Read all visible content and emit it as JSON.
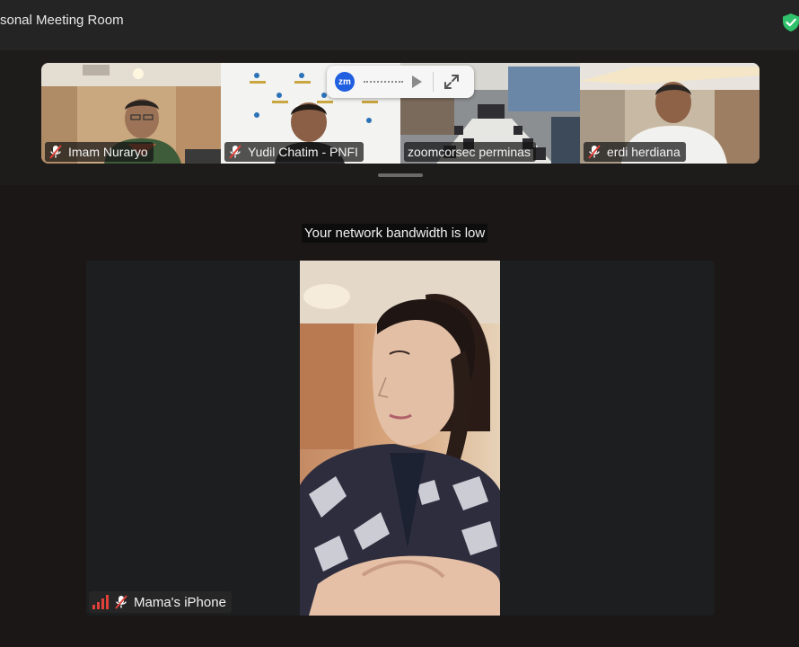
{
  "window": {
    "title": "sonal Meeting Room",
    "security_icon": "shield-check-icon",
    "colors": {
      "titlebar": "#242424",
      "background": "#1a1716",
      "security": "#2fc16b"
    }
  },
  "gallery": {
    "participants": [
      {
        "name": "Imam Nuraryo",
        "muted": true
      },
      {
        "name": "Yudil Chatim - PNFI",
        "muted": true
      },
      {
        "name": "zoomcorsec perminas",
        "muted": false
      },
      {
        "name": "erdi herdiana",
        "muted": true
      }
    ]
  },
  "share_toolbar": {
    "logo_text": "zm",
    "play_icon": "play-icon",
    "expand_icon": "expand-icon",
    "colors": {
      "logo": "#1f5fe0"
    }
  },
  "notice": {
    "text": "Your network bandwidth is low"
  },
  "active_speaker": {
    "name": "Mama's iPhone",
    "muted": true,
    "signal_icon": "signal-bars-icon",
    "colors": {
      "signal": "#e0413a"
    }
  }
}
